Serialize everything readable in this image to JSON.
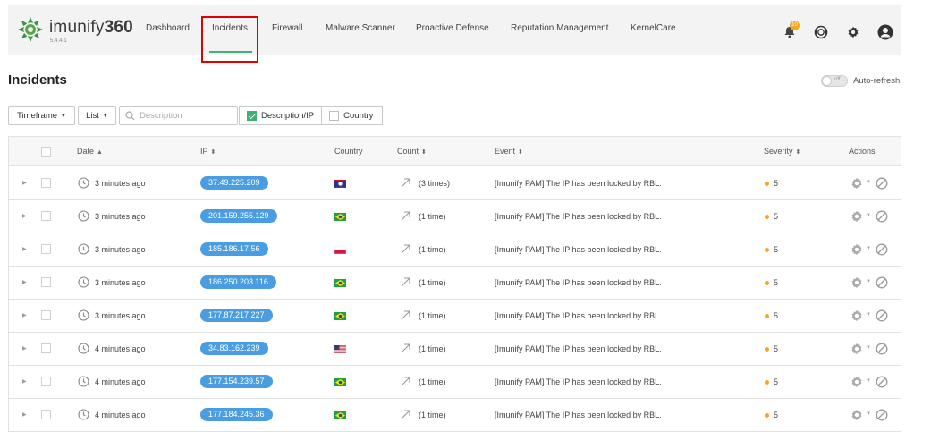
{
  "app": {
    "logo_text": "imunify",
    "logo_number": "360",
    "version": "5.4.4-1"
  },
  "nav": {
    "items": [
      {
        "label": "Dashboard"
      },
      {
        "label": "Incidents"
      },
      {
        "label": "Firewall"
      },
      {
        "label": "Malware Scanner"
      },
      {
        "label": "Proactive Defense"
      },
      {
        "label": "Reputation Management"
      },
      {
        "label": "KernelCare"
      }
    ],
    "active": "Incidents",
    "notification_count": "10",
    "icons": [
      "bell-icon",
      "support-icon",
      "gear-icon",
      "user-icon"
    ]
  },
  "page": {
    "title": "Incidents",
    "auto_refresh_label": "Auto-refresh",
    "auto_refresh_state": "off"
  },
  "filters": {
    "timeframe_label": "Timeframe",
    "list_label": "List",
    "search_placeholder": "Description",
    "search_value": "",
    "description_ip_label": "Description/IP",
    "description_ip_checked": true,
    "country_label": "Country",
    "country_checked": false
  },
  "table": {
    "columns": {
      "date": "Date",
      "ip": "IP",
      "country": "Country",
      "count": "Count",
      "event": "Event",
      "severity": "Severity",
      "actions": "Actions"
    },
    "rows": [
      {
        "date": "3 minutes ago",
        "ip": "37.49.225.209",
        "country_flag": "belize-flag",
        "count": "(3 times)",
        "event": "[Imunify PAM] The IP has been locked by RBL.",
        "severity": "5"
      },
      {
        "date": "3 minutes ago",
        "ip": "201.159.255.129",
        "country_flag": "brazil-flag",
        "count": "(1 time)",
        "event": "[Imunify PAM] The IP has been locked by RBL.",
        "severity": "5"
      },
      {
        "date": "3 minutes ago",
        "ip": "185.186.17.56",
        "country_flag": "poland-flag",
        "count": "(1 time)",
        "event": "[Imunify PAM] The IP has been locked by RBL.",
        "severity": "5"
      },
      {
        "date": "3 minutes ago",
        "ip": "186.250.203.116",
        "country_flag": "brazil-flag",
        "count": "(1 time)",
        "event": "[Imunify PAM] The IP has been locked by RBL.",
        "severity": "5"
      },
      {
        "date": "3 minutes ago",
        "ip": "177.87.217.227",
        "country_flag": "brazil-flag",
        "count": "(1 time)",
        "event": "[Imunify PAM] The IP has been locked by RBL.",
        "severity": "5"
      },
      {
        "date": "4 minutes ago",
        "ip": "34.83.162.239",
        "country_flag": "usa-flag",
        "count": "(1 time)",
        "event": "[Imunify PAM] The IP has been locked by RBL.",
        "severity": "5"
      },
      {
        "date": "4 minutes ago",
        "ip": "177.154.239.57",
        "country_flag": "brazil-flag",
        "count": "(1 time)",
        "event": "[Imunify PAM] The IP has been locked by RBL.",
        "severity": "5"
      },
      {
        "date": "4 minutes ago",
        "ip": "177.184.245.36",
        "country_flag": "brazil-flag",
        "count": "(1 time)",
        "event": "[Imunify PAM] The IP has been locked by RBL.",
        "severity": "5"
      }
    ]
  },
  "colors": {
    "accent_green": "#3cb371",
    "ip_pill_blue": "#4a9de0",
    "severity_orange": "#f5a623",
    "highlight_red": "#e00000"
  }
}
